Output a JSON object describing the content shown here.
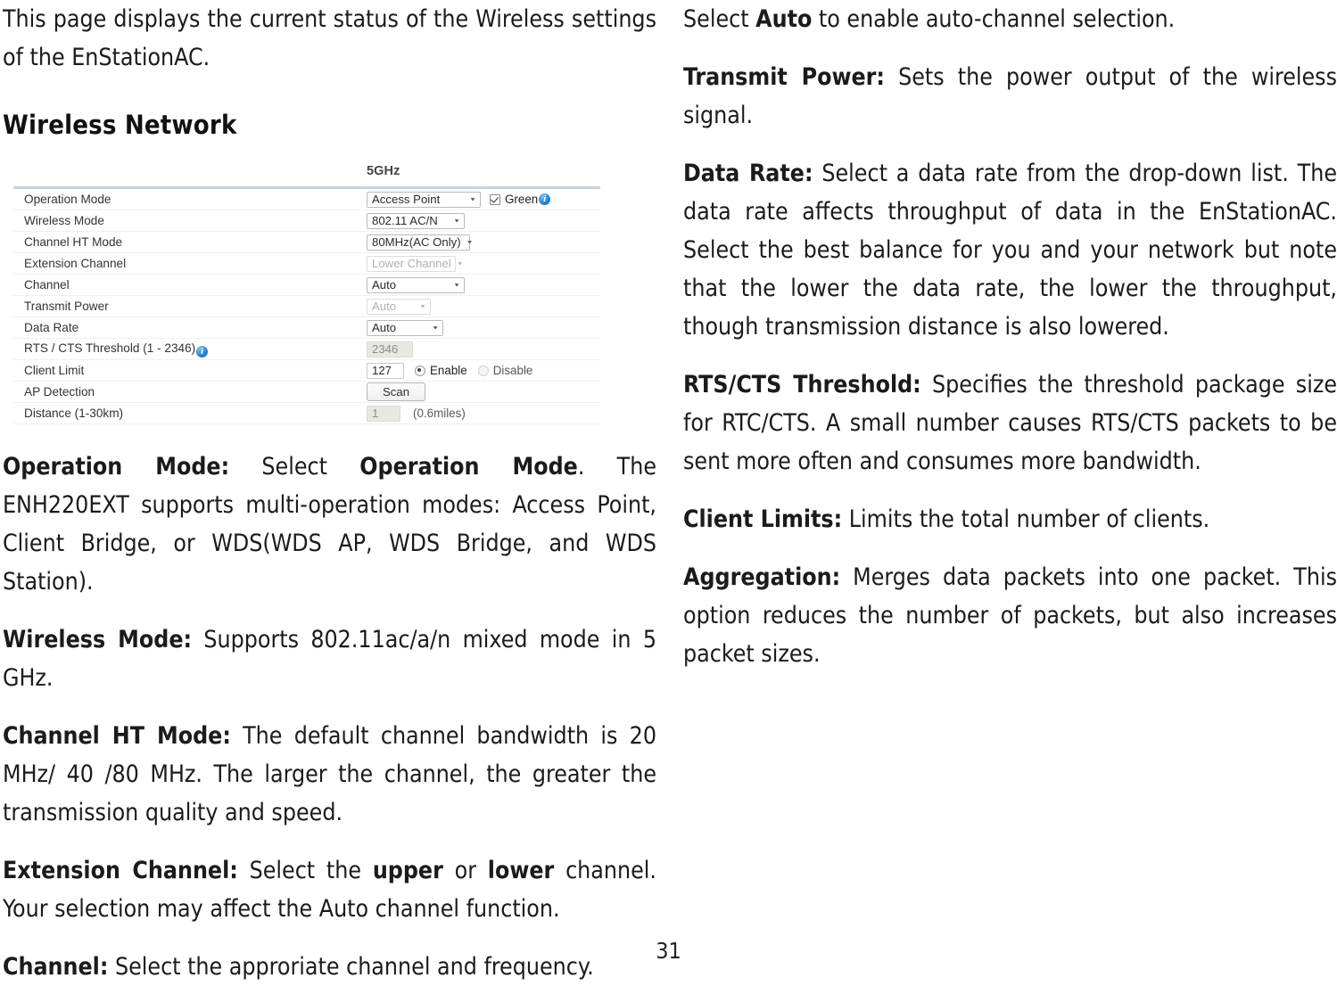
{
  "page": {
    "number": "31"
  },
  "left_column": {
    "intro": {
      "text": "This page displays the current status of the Wireless settings of the EnStationAC."
    },
    "section_heading": "Wireless Network",
    "paragraphs": [
      {
        "term": "Operation Mode:",
        "lead": " Select ",
        "emphasis": "Operation Mode",
        "rest": ". The ENH220EXT supports multi-operation modes: Access Point, Client Bridge, or WDS(WDS AP, WDS Bridge, and WDS Station)."
      },
      {
        "term": "Wireless Mode:",
        "rest": " Supports 802.11ac/a/n mixed mode in 5 GHz."
      },
      {
        "term": "Channel HT Mode:",
        "rest": " The default channel bandwidth is 20 MHz/ 40 /80 MHz. The larger the channel, the greater the transmission quality and speed."
      },
      {
        "term": "Extension Channel:",
        "lead": " Select the ",
        "emphasis": "upper",
        "mid": " or ",
        "emphasis2": "lower",
        "rest": " channel. Your selection may affect the Auto channel function."
      },
      {
        "term": "Channel:",
        "rest": " Select the approriate channel and frequency."
      }
    ]
  },
  "right_column": {
    "paragraphs": [
      {
        "lead": "Select ",
        "emphasis": "Auto",
        "rest": " to enable auto-channel selection."
      },
      {
        "term": "Transmit Power:",
        "rest": " Sets the power output of the wireless signal."
      },
      {
        "term": "Data Rate:",
        "rest": " Select a data rate from the drop-down list. The data rate affects throughput of data in the EnStationAC. Select the best balance for you and your network but note that the lower the data rate, the lower the throughput, though transmission distance is also lowered."
      },
      {
        "term": "RTS/CTS Threshold:",
        "rest": " Specifies the threshold package size for RTC/CTS. A small number causes RTS/CTS packets to be sent more often and consumes more bandwidth."
      },
      {
        "term": "Client Limits:",
        "rest": " Limits the total number of clients."
      },
      {
        "term": "Aggregation:",
        "rest": " Merges data packets into one packet. This option reduces the number of packets, but also increases packet sizes."
      }
    ]
  },
  "screenshot": {
    "band_title": "5GHz",
    "rows": [
      {
        "label": "Operation Mode",
        "control": "select",
        "value": "Access Point",
        "checkbox_label": "Green",
        "checkbox_checked": true,
        "has_info_icon": true
      },
      {
        "label": "Wireless Mode",
        "control": "select",
        "value": "802.11 AC/N"
      },
      {
        "label": "Channel HT Mode",
        "control": "select",
        "value": "80MHz(AC Only)"
      },
      {
        "label": "Extension Channel",
        "control": "select",
        "value": "Lower Channel",
        "disabled": true
      },
      {
        "label": "Channel",
        "control": "select",
        "value": "Auto"
      },
      {
        "label": "Transmit Power",
        "control": "select",
        "value": "Auto",
        "disabled": true
      },
      {
        "label": "Data Rate",
        "control": "select",
        "value": "Auto"
      },
      {
        "label": "RTS / CTS Threshold (1 - 2346)",
        "control": "input",
        "value": "2346",
        "readonly": true,
        "has_info_icon": true
      },
      {
        "label": "Client Limit",
        "control": "input",
        "value": "127",
        "radio_on": "Enable",
        "radio_off": "Disable"
      },
      {
        "label": "AP Detection",
        "control": "button",
        "value": "Scan"
      },
      {
        "label": "Distance (1-30km)",
        "control": "input",
        "value": "1",
        "readonly": true,
        "suffix": "(0.6miles)"
      }
    ]
  },
  "colors": {
    "table_top_border": "#c8d2e0",
    "row_divider": "#f1f1f1",
    "info_icon": "#2a83d4",
    "readonly_field": "#e9e7e3",
    "text": "#1b1b1b"
  }
}
